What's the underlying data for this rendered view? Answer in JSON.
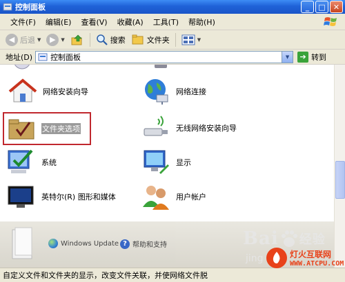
{
  "window": {
    "title": "控制面板"
  },
  "menu": [
    "文件(F)",
    "编辑(E)",
    "查看(V)",
    "收藏(A)",
    "工具(T)",
    "帮助(H)"
  ],
  "toolbar": {
    "back_label": "后退",
    "search_label": "搜索",
    "folders_label": "文件夹"
  },
  "address": {
    "label": "地址(D)",
    "value": "控制面板",
    "go_label": "转到"
  },
  "items": [
    {
      "label": "网络安装向导",
      "icon": "home-network-icon"
    },
    {
      "label": "网络连接",
      "icon": "network-globe-icon"
    },
    {
      "label": "文件夹选项",
      "icon": "folder-options-icon",
      "selected": true
    },
    {
      "label": "无线网络安装向导",
      "icon": "wireless-icon"
    },
    {
      "label": "系统",
      "icon": "system-icon"
    },
    {
      "label": "显示",
      "icon": "display-icon"
    },
    {
      "label": "英特尔(R) 图形和媒体",
      "icon": "intel-graphics-icon"
    },
    {
      "label": "用户帐户",
      "icon": "user-accounts-icon"
    }
  ],
  "tasks": {
    "windows_update": "Windows Update",
    "help_support": "帮助和支持"
  },
  "status": {
    "text": "自定义文件和文件夹的显示，改变文件关联，并使网络文件脱"
  },
  "watermark": {
    "baidu": "Bai",
    "baidu_cn": "经验",
    "sub": "jing",
    "site_cn": "灯火互联网",
    "site_url": "WWW.ATCPU.COM"
  },
  "colors": {
    "title_bar": "#1f62d8",
    "chrome": "#ece9d8",
    "selection_outline": "#c0272d",
    "logo": "#e8421a"
  }
}
